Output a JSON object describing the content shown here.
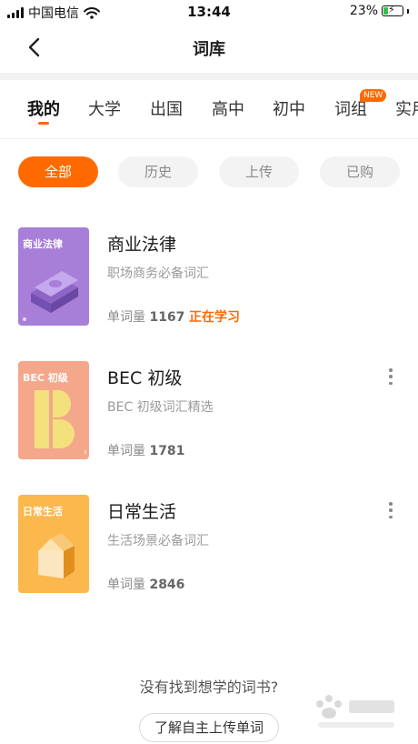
{
  "status_bar": {
    "carrier": "中国电信",
    "time": "13:44",
    "battery_percent": "23%",
    "battery_level": 0.23
  },
  "nav": {
    "title": "词库",
    "back_icon": "chevron-left-icon"
  },
  "tabs": [
    {
      "label": "我的",
      "active": true
    },
    {
      "label": "大学"
    },
    {
      "label": "出国"
    },
    {
      "label": "高中"
    },
    {
      "label": "初中"
    },
    {
      "label": "词组",
      "badge": "NEW"
    },
    {
      "label": "实用"
    }
  ],
  "filters": [
    {
      "label": "全部",
      "active": true
    },
    {
      "label": "历史"
    },
    {
      "label": "上传"
    },
    {
      "label": "已购"
    }
  ],
  "books": [
    {
      "cover_text": "商业法律",
      "cover_color": "#a77fd8",
      "title": "商业法律",
      "subtitle": "职场商务必备词汇",
      "count_label": "单词量",
      "count": "1167",
      "status": "正在学习"
    },
    {
      "cover_text": "BEC 初级",
      "cover_color": "#f4a78a",
      "title": "BEC 初级",
      "subtitle": "BEC 初级词汇精选",
      "count_label": "单词量",
      "count": "1781"
    },
    {
      "cover_text": "日常生活",
      "cover_color": "#fbb84c",
      "title": "日常生活",
      "subtitle": "生活场景必备词汇",
      "count_label": "单词量",
      "count": "2846"
    }
  ],
  "footer": {
    "question": "没有找到想学的词书?",
    "upload_button": "了解自主上传单词"
  },
  "colors": {
    "accent": "#ff6a00"
  }
}
